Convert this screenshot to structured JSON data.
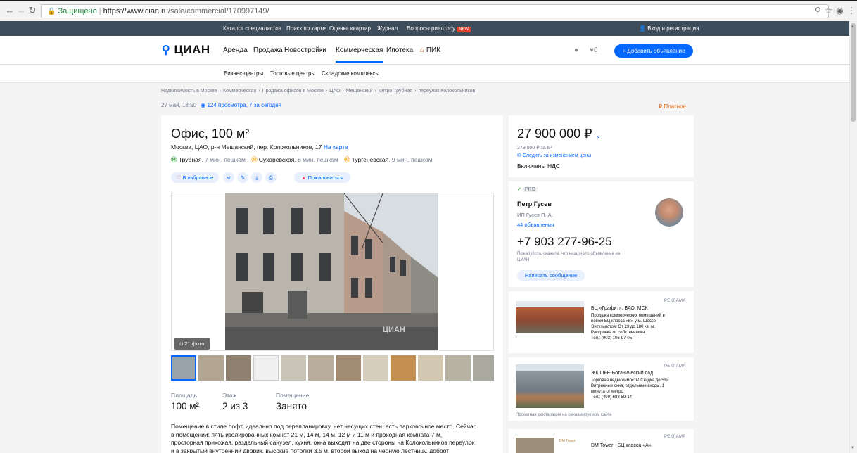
{
  "browser": {
    "secure_label": "Защищено",
    "url_host": "https://www.cian.ru",
    "url_path": "/sale/commercial/170997149/"
  },
  "topbar": {
    "links": [
      "Каталог специалистов",
      "Поиск по карте",
      "Оценка квартир",
      "Журнал",
      "Вопросы риелтору"
    ],
    "new_badge": "NEW",
    "login": "Вход и регистрация"
  },
  "header": {
    "logo": "ЦИАН",
    "nav": [
      "Аренда",
      "Продажа",
      "Новостройки",
      "Коммерческая",
      "Ипотека",
      "ПИК"
    ],
    "favorites_count": "0",
    "add_button": "+ Добавить объявление"
  },
  "subnav": [
    "Бизнес-центры",
    "Торговые центры",
    "Складские комплексы"
  ],
  "breadcrumbs": [
    "Недвижимость в Москве",
    "Коммерческая",
    "Продажа офисов в Москве",
    "ЦАО",
    "Мещанский",
    "метро Трубная",
    "переулок Колокольников"
  ],
  "meta": {
    "date": "27 май, 18:50",
    "views": "124 просмотра, 7 за сегодня",
    "paid": "Платное"
  },
  "listing": {
    "title": "Офис, 100 м²",
    "address": "Москва, ЦАО, р-н Мещанский, пер. Колокольников, 17",
    "map_link": "На карте",
    "metro": [
      {
        "name": "Трубная",
        "time": ", 7 мин. пешком"
      },
      {
        "name": "Сухаревская",
        "time": ", 8 мин. пешком"
      },
      {
        "name": "Тургеневская",
        "time": ", 9 мин. пешком"
      }
    ],
    "favorite_label": "В избранное",
    "complain_label": "Пожаловаться",
    "photo_count": "21 фото",
    "watermark": "ЦИАН",
    "params": [
      {
        "label": "Площадь",
        "value": "100 м²"
      },
      {
        "label": "Этаж",
        "value": "2 из 3"
      },
      {
        "label": "Помещение",
        "value": "Занято"
      }
    ],
    "description": [
      "Помещение в стиле лофт, идеально под перепланировку, нет несущих стен, есть парковочное место. Сейчас",
      "в помещении: пять изолированных комнат 21 м, 14 м, 14 м, 12 м и 11 м и проходная комната 7 м,",
      "просторная прихожая, раздельный санузел, кухня, окна выходят на две стороны на Колокольников переулок",
      "и в закрытый внутренний дворик, высокие потолки 3,5 м, второй выход на черную лестницу, доброт"
    ]
  },
  "price": {
    "value": "27 900 000 ₽",
    "per_meter": "279 000 ₽ за м²",
    "follow": "Следить за изменением цены",
    "vat": "Включены НДС"
  },
  "agent": {
    "pro": "PRO",
    "name": "Петр Гусев",
    "company": "ИП Гусев П. А.",
    "listings": "44 объявления",
    "phone": "+7 903 277-96-25",
    "note_line1": "Пожалуйста, скажите, что нашли это объявление на",
    "note_line2": "ЦИАН",
    "message_button": "Написать сообщение"
  },
  "ads": [
    {
      "label": "РЕКЛАМА",
      "title": "БЦ «Графит», ВАО, МСК",
      "lines": [
        "Продажа коммерческих помещений в",
        "новом БЦ класса «В» у м. Шоссе",
        "Энтузиастов! От 23 до 180 кв. м.",
        "Рассрочка от собственника",
        "Тел.: (903) 106-97-05"
      ]
    },
    {
      "label": "РЕКЛАМА",
      "title": "ЖК LIFE-Ботанический сад",
      "lines": [
        "Торговая недвижимость! Скидка до 5%!",
        "Витринные окна, отдельные входы. 1",
        "минута от метро",
        "Тел.: (499) 688-89-14"
      ],
      "footer": "Проектная декларация на рекламируемом сайте"
    },
    {
      "label": "РЕКЛАМА",
      "title": "DM Tower - БЦ класса «А»",
      "brand": "DM Tower"
    }
  ],
  "colors": {
    "brand_blue": "#0468ff",
    "dark_bar": "#3e4d5c",
    "metro_orange": "#f5a623",
    "paid_orange": "#f76c11"
  }
}
